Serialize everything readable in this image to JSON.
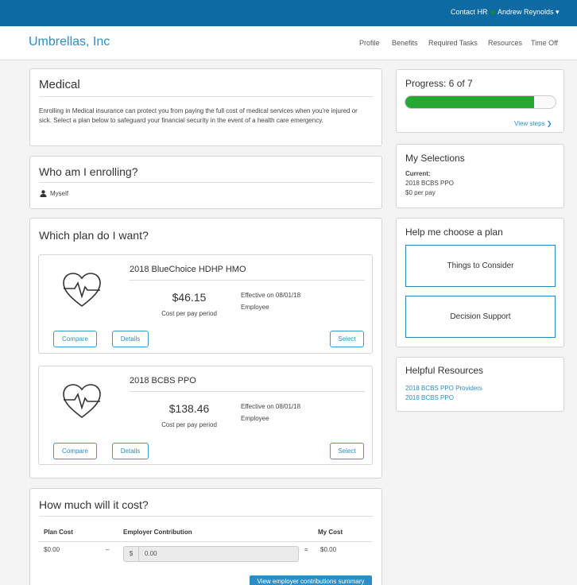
{
  "topbar": {
    "contact_label": "Contact HR",
    "user_label": "Andrew Reynolds ▾"
  },
  "header": {
    "brand": "Umbrellas, Inc",
    "nav": [
      "Profile",
      "Benefits",
      "Required Tasks",
      "Resources",
      "Time Off"
    ]
  },
  "medical": {
    "title": "Medical",
    "description": "Enrolling in Medical insurance can protect you from paying the full cost of medical services when you're injured or sick. Select a plan below to safeguard your financial security in the event of a health care emergency."
  },
  "enrolling": {
    "title": "Who am I enrolling?",
    "person": "Myself"
  },
  "plans_section": {
    "title": "Which plan do I want?",
    "plans": [
      {
        "name": "2018 BlueChoice HDHP HMO",
        "price": "$46.15",
        "price_label": "Cost per pay period",
        "effective": "Effective on 08/01/18",
        "coverage": "Employee",
        "compare_label": "Compare",
        "details_label": "Details",
        "select_label": "Select"
      },
      {
        "name": "2018 BCBS PPO",
        "price": "$138.46",
        "price_label": "Cost per pay period",
        "effective": "Effective on 08/01/18",
        "coverage": "Employee",
        "compare_label": "Compare",
        "details_label": "Details",
        "select_label": "Select"
      }
    ]
  },
  "cost": {
    "title": "How much will it cost?",
    "headers": {
      "plan_cost": "Plan Cost",
      "employer": "Employer Contribution",
      "my_cost": "My Cost"
    },
    "plan_cost": "$0.00",
    "minus": "–",
    "currency": "$",
    "employer_value": "0.00",
    "equals": "=",
    "my_cost": "$0.00",
    "summary_button": "View employer contributions summary"
  },
  "progress": {
    "title": "Progress: 6 of 7",
    "completed": 6,
    "total": 7,
    "view_steps": "View steps ❯"
  },
  "selections": {
    "title": "My Selections",
    "current_label": "Current:",
    "plan": "2018 BCBS PPO",
    "cost": "$0 per pay"
  },
  "help": {
    "title": "Help me choose a plan",
    "options": [
      "Things to Consider",
      "Decision Support"
    ]
  },
  "resources": {
    "title": "Helpful Resources",
    "links": [
      "2018 BCBS PPO Providers",
      "2018 BCBS PPO"
    ]
  },
  "colors": {
    "topbar": "#0d6aa3",
    "accent": "#2a8fc6",
    "progress": "#27a835"
  },
  "icons": {
    "plan_icon": "heart-pulse-icon",
    "person_icon": "user-icon",
    "chevron": "chevron-right-icon"
  }
}
